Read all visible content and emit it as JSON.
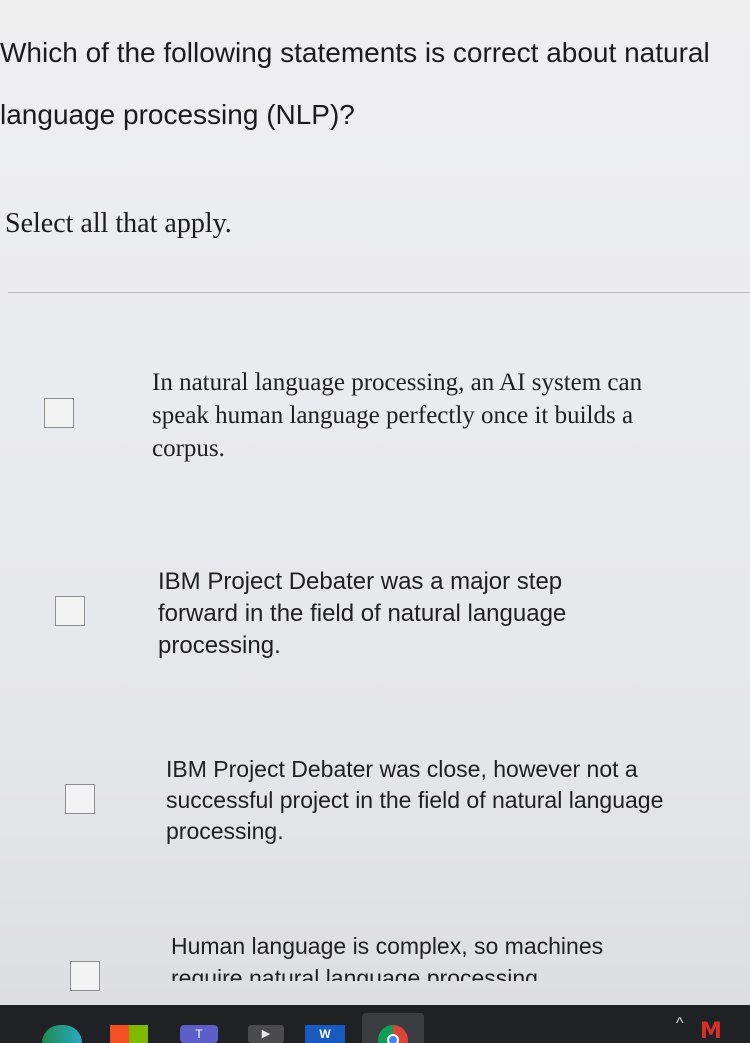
{
  "question": {
    "text": "Which of the following statements is correct about natural\nlanguage processing (NLP)?"
  },
  "instruction": "Select all that apply.",
  "options": [
    {
      "text": "In natural language processing, an AI system can speak human language perfectly once it builds a corpus.",
      "checked": false
    },
    {
      "text": "IBM Project Debater was a major step forward in the field of natural language processing.",
      "checked": false
    },
    {
      "text": "IBM Project Debater was close, however not a successful project in the field of natural language processing.",
      "checked": false
    },
    {
      "text": "Human language is complex, so machines require natural language processing",
      "checked": false
    }
  ],
  "taskbar": {
    "teams_label": "T",
    "word_label": "W",
    "gmail_label": "M",
    "chevron": "^"
  }
}
